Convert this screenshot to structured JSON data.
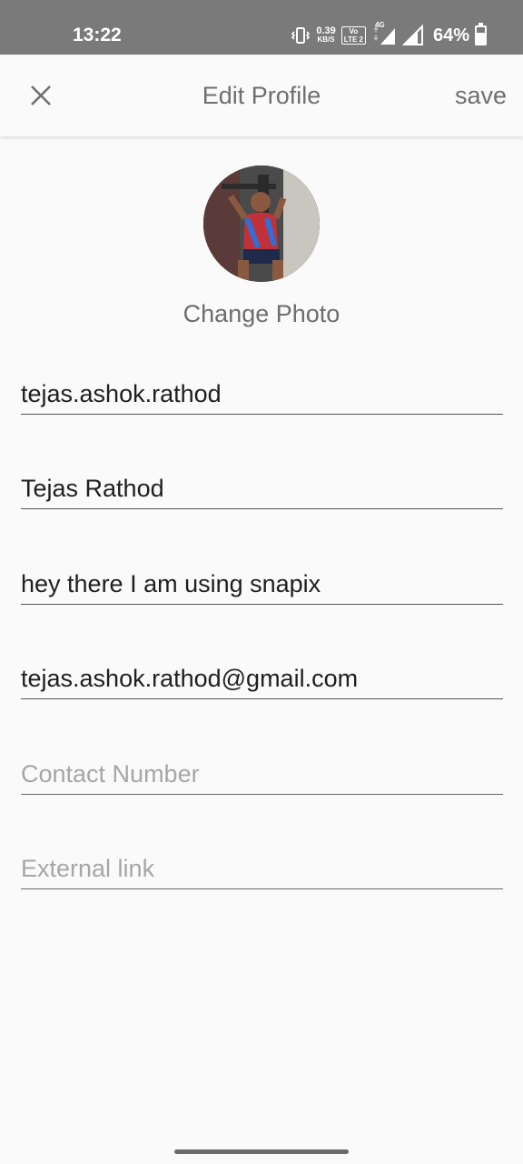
{
  "status_bar": {
    "time": "13:22",
    "speed_value": "0.39",
    "speed_unit": "KB/S",
    "volte_top": "Vo",
    "volte_bottom": "LTE 2",
    "network": "4G",
    "battery_percent": "64%",
    "battery_level": 0.64
  },
  "appbar": {
    "title": "Edit Profile",
    "save_label": "save",
    "close_icon": "close-icon"
  },
  "profile": {
    "change_photo_label": "Change Photo"
  },
  "fields": {
    "username": {
      "value": "tejas.ashok.rathod",
      "placeholder": ""
    },
    "name": {
      "value": "Tejas Rathod",
      "placeholder": ""
    },
    "bio": {
      "value": "hey there I am using snapix",
      "placeholder": ""
    },
    "email": {
      "value": "tejas.ashok.rathod@gmail.com",
      "placeholder": ""
    },
    "contact": {
      "value": "",
      "placeholder": "Contact Number"
    },
    "link": {
      "value": "",
      "placeholder": "External link"
    }
  },
  "colors": {
    "status_bar": "#7a7a7a",
    "background": "#fafafa",
    "text": "#1f1f1f",
    "secondary_text": "#6f6f6f",
    "placeholder": "#a6a6a6"
  }
}
